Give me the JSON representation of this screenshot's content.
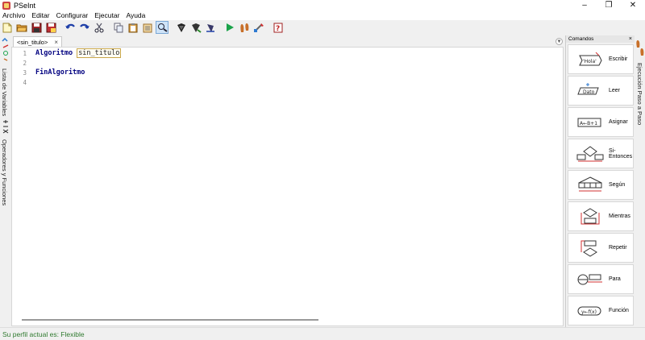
{
  "window": {
    "title": "PSeInt"
  },
  "menu": [
    "Archivo",
    "Editar",
    "Configurar",
    "Ejecutar",
    "Ayuda"
  ],
  "toolbar": {
    "icons": [
      "new-file-icon",
      "open-folder-icon",
      "save-icon",
      "save-as-icon",
      "undo-icon",
      "redo-icon",
      "cut-icon",
      "copy-icon",
      "paste-icon",
      "paste-special-icon",
      "find-icon",
      "indent-icon",
      "comment-icon",
      "uncomment-icon",
      "run-icon",
      "step-by-step-icon",
      "draw-flowchart-icon",
      "help-icon"
    ]
  },
  "left_panel": {
    "variables_label": "Lista de Variables",
    "operators_label": "Operadores y Funciones"
  },
  "editor": {
    "tab_label": "<sin_titulo>",
    "tab_close": "×",
    "lines": [
      {
        "n": "1",
        "kw": "Algoritmo",
        "ident": "sin_titulo"
      },
      {
        "n": "2",
        "kw": "",
        "ident": ""
      },
      {
        "n": "3",
        "kw": "FinAlgoritmo",
        "ident": ""
      },
      {
        "n": "4",
        "kw": "",
        "ident": ""
      }
    ]
  },
  "commands_panel": {
    "title": "Comandos",
    "close": "×",
    "items": [
      {
        "label": "Escribir",
        "icon": "write-icon",
        "glyph": "'Hola'"
      },
      {
        "label": "Leer",
        "icon": "read-icon",
        "glyph": "Dato"
      },
      {
        "label": "Asignar",
        "icon": "assign-icon",
        "glyph": "A←B+1"
      },
      {
        "label": "Si-Entonces",
        "icon": "if-then-icon",
        "glyph": ""
      },
      {
        "label": "Según",
        "icon": "switch-icon",
        "glyph": ""
      },
      {
        "label": "Mientras",
        "icon": "while-icon",
        "glyph": ""
      },
      {
        "label": "Repetir",
        "icon": "repeat-icon",
        "glyph": ""
      },
      {
        "label": "Para",
        "icon": "for-icon",
        "glyph": ""
      },
      {
        "label": "Función",
        "icon": "function-icon",
        "glyph": "y←f(x)"
      }
    ]
  },
  "right_panel": {
    "step_label": "Ejecución Paso a Paso"
  },
  "status": {
    "text": "Su perfil actual es: Flexible"
  },
  "colors": {
    "keyword": "#000080",
    "status": "#2f7a2f",
    "accent": "#c8a64a"
  }
}
